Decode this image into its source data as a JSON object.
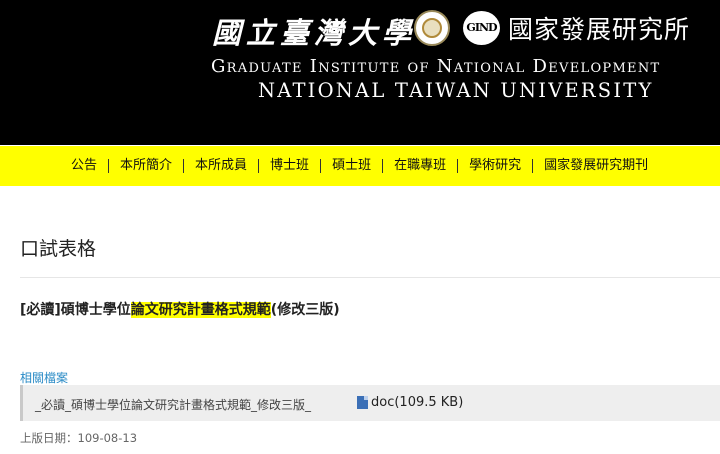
{
  "header": {
    "university_calligraphy": "國立臺灣大學",
    "institute_logo_text": "GIND",
    "institute_name_cn": "國家發展研究所",
    "institute_name_en": "Graduate Institute of National Development",
    "university_name_en": "NATIONAL TAIWAN UNIVERSITY",
    "header_bg": "#000000"
  },
  "nav": {
    "bg": "#ffff00",
    "items": [
      {
        "label": "公告"
      },
      {
        "label": "本所簡介"
      },
      {
        "label": "本所成員"
      },
      {
        "label": "博士班"
      },
      {
        "label": "碩士班"
      },
      {
        "label": "在職專班"
      },
      {
        "label": "學術研究"
      },
      {
        "label": "國家發展研究期刊"
      }
    ]
  },
  "main": {
    "page_title": "口試表格",
    "doc_title": {
      "prefix": "[必讀]碩博士學位",
      "highlight": "論文研究計畫格式規範",
      "suffix": "(修改三版)",
      "highlight_color": "#ffff00"
    },
    "files_label": "相關檔案",
    "files": [
      {
        "name": "_必讀_碩博士學位論文研究計畫格式規範_修改三版_",
        "icon": "word-doc-icon",
        "type_size": "doc(109.5 KB)"
      }
    ],
    "updated": "上版日期：109-08-13",
    "link_color": "#2a8bc6"
  }
}
